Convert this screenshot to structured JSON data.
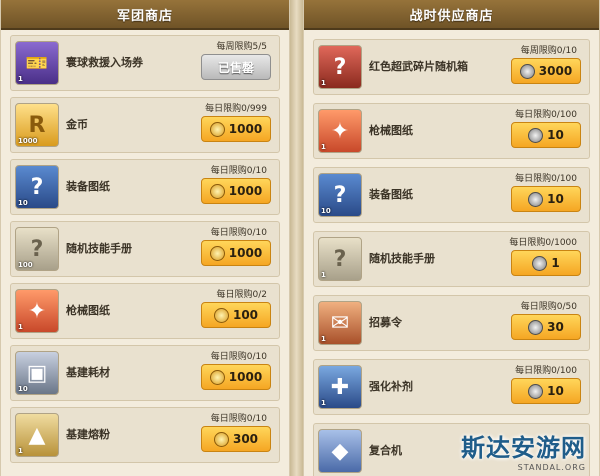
{
  "left_panel": {
    "title": "军团商店",
    "items": [
      {
        "name": "寰球救援入场券",
        "limit": "每周限购5/5",
        "price": "已售罄",
        "sold_out": true,
        "count": "1",
        "icon": "ticket-icon",
        "color": "#6b4ca8"
      },
      {
        "name": "金币",
        "limit": "每日限购0/999",
        "price": "1000",
        "sold_out": false,
        "count": "1000",
        "icon": "gold-coin-icon",
        "color": "#d9a21b"
      },
      {
        "name": "装备图纸",
        "limit": "每日限购0/10",
        "price": "1000",
        "sold_out": false,
        "count": "10",
        "icon": "equipment-blueprint-icon",
        "color": "#3a5ea8"
      },
      {
        "name": "随机技能手册",
        "limit": "每日限购0/10",
        "price": "1000",
        "sold_out": false,
        "count": "100",
        "icon": "skill-manual-icon",
        "color": "#a8a08a"
      },
      {
        "name": "枪械图纸",
        "limit": "每日限购0/2",
        "price": "100",
        "sold_out": false,
        "count": "1",
        "icon": "gun-blueprint-icon",
        "color": "#e0643c"
      },
      {
        "name": "基建耗材",
        "limit": "每日限购0/10",
        "price": "1000",
        "sold_out": false,
        "count": "10",
        "icon": "construction-material-icon",
        "color": "#8a96a8"
      },
      {
        "name": "基建熔粉",
        "limit": "每日限购0/10",
        "price": "300",
        "sold_out": false,
        "count": "1",
        "icon": "construction-powder-icon",
        "color": "#c8a24a"
      }
    ]
  },
  "right_panel": {
    "title": "战时供应商店",
    "items": [
      {
        "name": "红色超武碎片随机箱",
        "limit": "每周限购0/10",
        "price": "3000",
        "count": "1",
        "icon": "red-chest-icon",
        "color": "#b83a2a"
      },
      {
        "name": "枪械图纸",
        "limit": "每日限购0/100",
        "price": "10",
        "count": "1",
        "icon": "gun-blueprint-icon",
        "color": "#e0643c"
      },
      {
        "name": "装备图纸",
        "limit": "每日限购0/100",
        "price": "10",
        "count": "10",
        "icon": "equipment-blueprint-icon",
        "color": "#3a5ea8"
      },
      {
        "name": "随机技能手册",
        "limit": "每日限购0/1000",
        "price": "1",
        "count": "1",
        "icon": "skill-manual-icon",
        "color": "#a8a08a"
      },
      {
        "name": "招募令",
        "limit": "每日限购0/50",
        "price": "30",
        "count": "1",
        "icon": "recruit-order-icon",
        "color": "#c86a3a"
      },
      {
        "name": "强化补剂",
        "limit": "每日限购0/100",
        "price": "10",
        "count": "1",
        "icon": "syringe-icon",
        "color": "#3a6ab8"
      },
      {
        "name": "复合机",
        "limit": "",
        "price": "",
        "count": "",
        "icon": "composite-icon",
        "color": "#5a7ab8"
      }
    ]
  },
  "watermark": {
    "main": "斯达安游网",
    "sub": "STANDAL.ORG"
  }
}
